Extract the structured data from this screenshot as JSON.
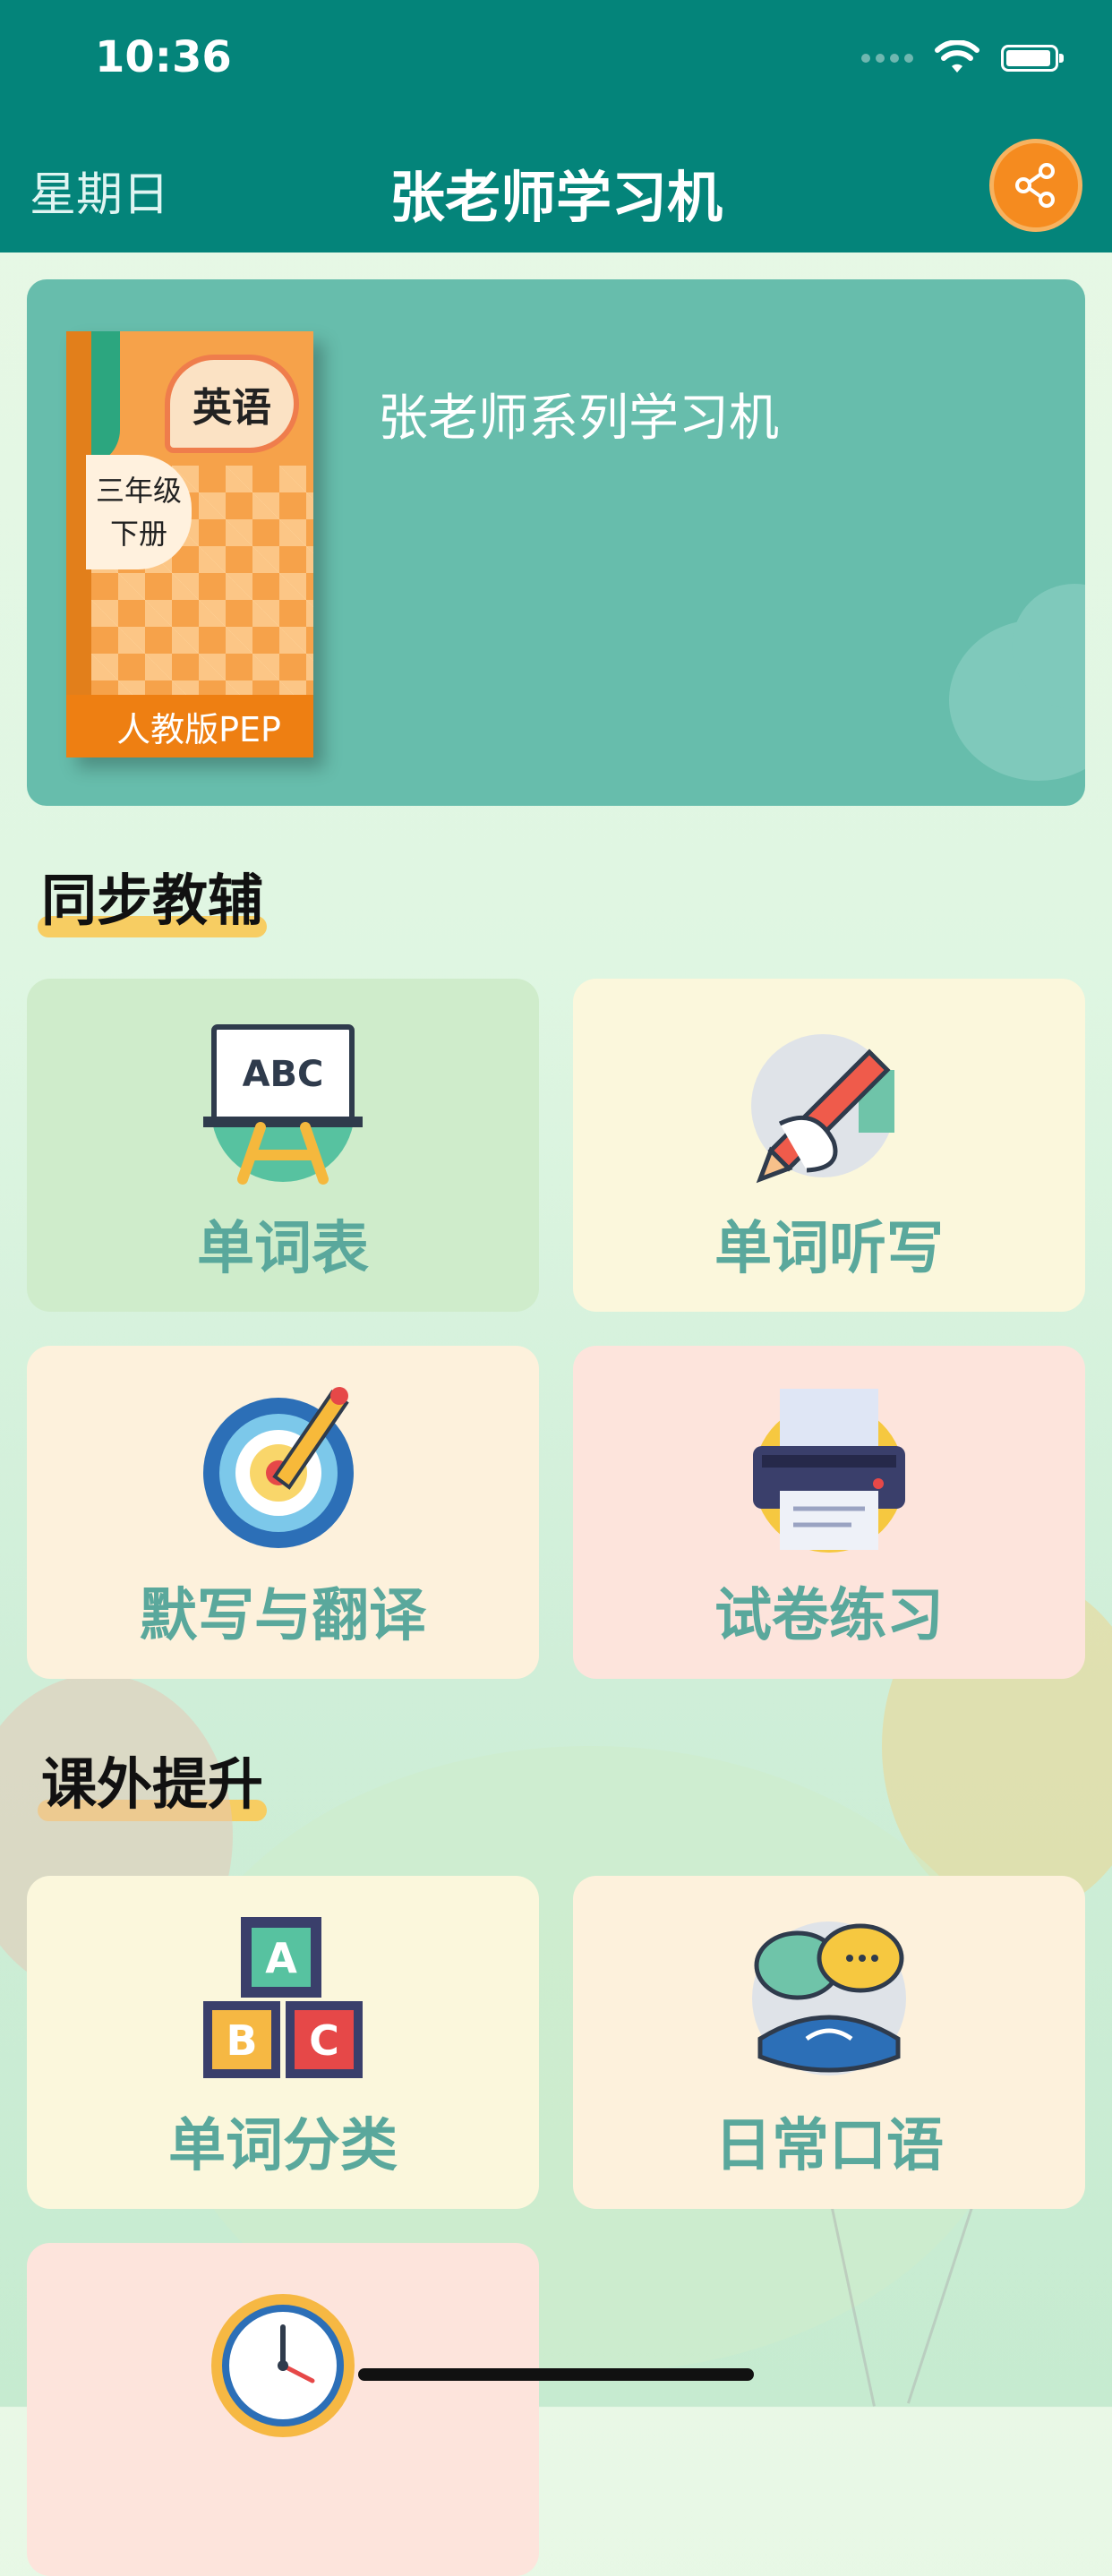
{
  "status_bar": {
    "time": "10:36"
  },
  "header": {
    "day": "星期日",
    "title": "张老师学习机",
    "share_icon": "share-icon"
  },
  "banner": {
    "title": "张老师系列学习机",
    "book": {
      "subject": "英语",
      "grade_line1": "三年级",
      "grade_line2": "下册",
      "edition": "人教版PEP"
    }
  },
  "sections": [
    {
      "title": "同步教辅",
      "items": [
        {
          "label": "单词表",
          "icon": "abc-board-icon"
        },
        {
          "label": "单词听写",
          "icon": "pencil-writing-icon"
        },
        {
          "label": "默写与翻译",
          "icon": "target-pencil-icon"
        },
        {
          "label": "试卷练习",
          "icon": "printer-icon"
        }
      ]
    },
    {
      "title": "课外提升",
      "items": [
        {
          "label": "单词分类",
          "icon": "abc-blocks-icon"
        },
        {
          "label": "日常口语",
          "icon": "chat-phone-icon"
        },
        {
          "label": "",
          "icon": "clock-icon"
        }
      ]
    }
  ],
  "colors": {
    "header": "#04847a",
    "banner": "#67bdac",
    "share_button": "#f58b1f",
    "card_label": "#5aa89c",
    "title_highlight": "#f7cd62"
  }
}
